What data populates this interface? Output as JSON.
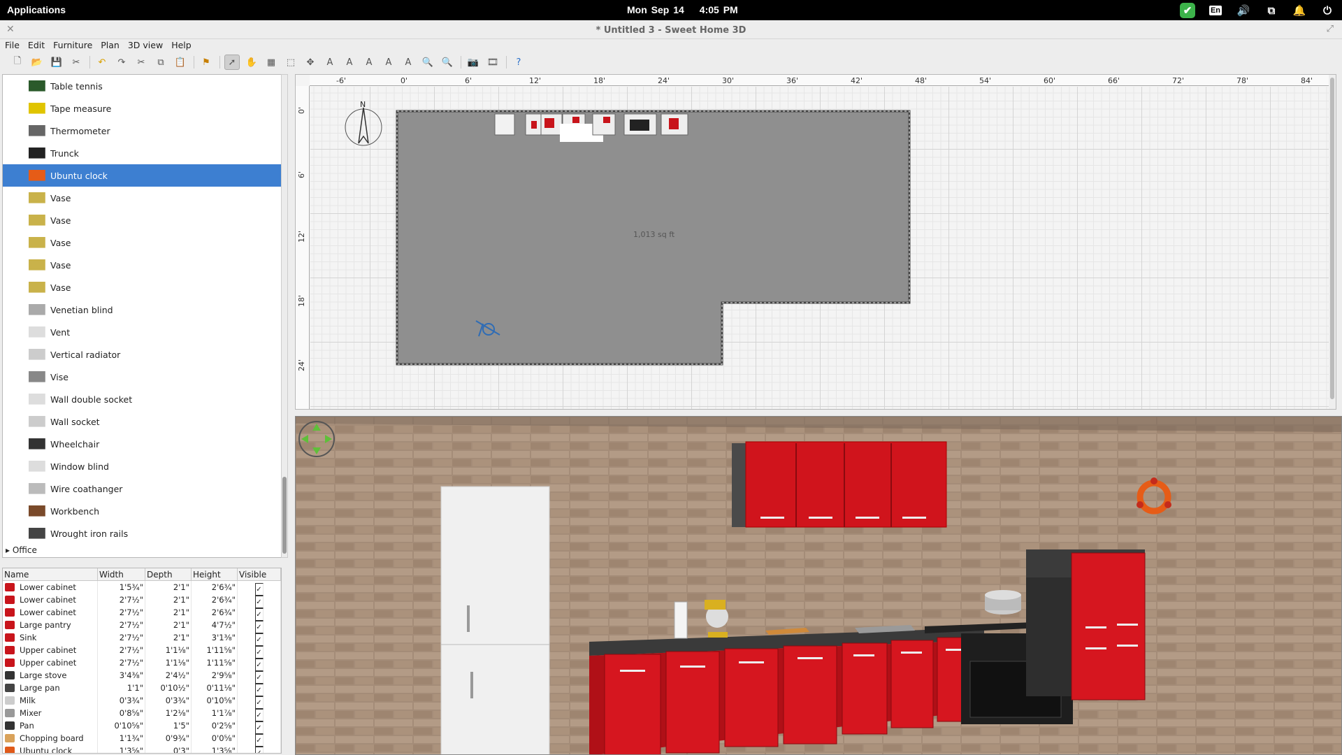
{
  "topbar": {
    "applications": "Applications",
    "date": "Mon Sep 14",
    "time": "4:05 PM",
    "lang": "En"
  },
  "window": {
    "title": "* Untitled 3 - Sweet Home 3D"
  },
  "menu": [
    "File",
    "Edit",
    "Furniture",
    "Plan",
    "3D view",
    "Help"
  ],
  "catalog": {
    "items": [
      {
        "label": "Table tennis",
        "icon": "table-tennis-icon"
      },
      {
        "label": "Tape measure",
        "icon": "tape-measure-icon"
      },
      {
        "label": "Thermometer",
        "icon": "thermometer-icon"
      },
      {
        "label": "Trunck",
        "icon": "trunk-icon"
      },
      {
        "label": "Ubuntu clock",
        "icon": "ubuntu-clock-icon",
        "selected": true
      },
      {
        "label": "Vase",
        "icon": "vase-icon"
      },
      {
        "label": "Vase",
        "icon": "vase-icon"
      },
      {
        "label": "Vase",
        "icon": "vase-icon"
      },
      {
        "label": "Vase",
        "icon": "vase-icon"
      },
      {
        "label": "Vase",
        "icon": "vase-icon"
      },
      {
        "label": "Venetian blind",
        "icon": "venetian-blind-icon"
      },
      {
        "label": "Vent",
        "icon": "vent-icon"
      },
      {
        "label": "Vertical radiator",
        "icon": "radiator-icon"
      },
      {
        "label": "Vise",
        "icon": "vise-icon"
      },
      {
        "label": "Wall double socket",
        "icon": "double-socket-icon"
      },
      {
        "label": "Wall socket",
        "icon": "socket-icon"
      },
      {
        "label": "Wheelchair",
        "icon": "wheelchair-icon"
      },
      {
        "label": "Window blind",
        "icon": "window-blind-icon"
      },
      {
        "label": "Wire coathanger",
        "icon": "coathanger-icon"
      },
      {
        "label": "Workbench",
        "icon": "workbench-icon"
      },
      {
        "label": "Wrought iron rails",
        "icon": "iron-rails-icon"
      }
    ],
    "next_category": "Office"
  },
  "furniture_table": {
    "headers": [
      "Name",
      "Width",
      "Depth",
      "Height",
      "Visible"
    ],
    "rows": [
      {
        "name": "Lower cabinet",
        "width": "1'5¾\"",
        "depth": "2'1\"",
        "height": "2'6¾\"",
        "color": "#c8141b"
      },
      {
        "name": "Lower cabinet",
        "width": "2'7½\"",
        "depth": "2'1\"",
        "height": "2'6¾\"",
        "color": "#c8141b"
      },
      {
        "name": "Lower cabinet",
        "width": "2'7½\"",
        "depth": "2'1\"",
        "height": "2'6¾\"",
        "color": "#c8141b"
      },
      {
        "name": "Large pantry",
        "width": "2'7½\"",
        "depth": "2'1\"",
        "height": "4'7½\"",
        "color": "#c8141b"
      },
      {
        "name": "Sink",
        "width": "2'7½\"",
        "depth": "2'1\"",
        "height": "3'1⅜\"",
        "color": "#c8141b"
      },
      {
        "name": "Upper cabinet",
        "width": "2'7½\"",
        "depth": "1'1⅛\"",
        "height": "1'11⅝\"",
        "color": "#c8141b"
      },
      {
        "name": "Upper cabinet",
        "width": "2'7½\"",
        "depth": "1'1⅛\"",
        "height": "1'11⅝\"",
        "color": "#c8141b"
      },
      {
        "name": "Large stove",
        "width": "3'4⅜\"",
        "depth": "2'4½\"",
        "height": "2'9⅝\"",
        "color": "#333333"
      },
      {
        "name": "Large pan",
        "width": "1'1\"",
        "depth": "0'10½\"",
        "height": "0'11⅛\"",
        "color": "#444444"
      },
      {
        "name": "Milk",
        "width": "0'3¾\"",
        "depth": "0'3¾\"",
        "height": "0'10⅝\"",
        "color": "#cccccc"
      },
      {
        "name": "Mixer",
        "width": "0'8⅝\"",
        "depth": "1'2⅛\"",
        "height": "1'1⅞\"",
        "color": "#999999"
      },
      {
        "name": "Pan",
        "width": "0'10⅝\"",
        "depth": "1'5\"",
        "height": "0'2⅝\"",
        "color": "#333333"
      },
      {
        "name": "Chopping board",
        "width": "1'1¾\"",
        "depth": "0'9¾\"",
        "height": "0'0⅝\"",
        "color": "#d9a25a"
      },
      {
        "name": "Ubuntu clock",
        "width": "1'3⅝\"",
        "depth": "0'3\"",
        "height": "1'3⅝\"",
        "color": "#e05a1a"
      }
    ]
  },
  "plan": {
    "ruler_x": [
      "-6'",
      "0'",
      "6'",
      "12'",
      "18'",
      "24'",
      "30'",
      "36'",
      "42'",
      "48'",
      "54'",
      "60'",
      "66'",
      "72'",
      "78'",
      "84'"
    ],
    "ruler_y": [
      "0'",
      "6'",
      "12'",
      "18'",
      "24'"
    ],
    "area_label": "1,013 sq ft",
    "compass_label": "N"
  },
  "colors": {
    "selection": "#3d7fd1",
    "cabinet_red": "#d0141c",
    "brick": "#9b8472"
  }
}
